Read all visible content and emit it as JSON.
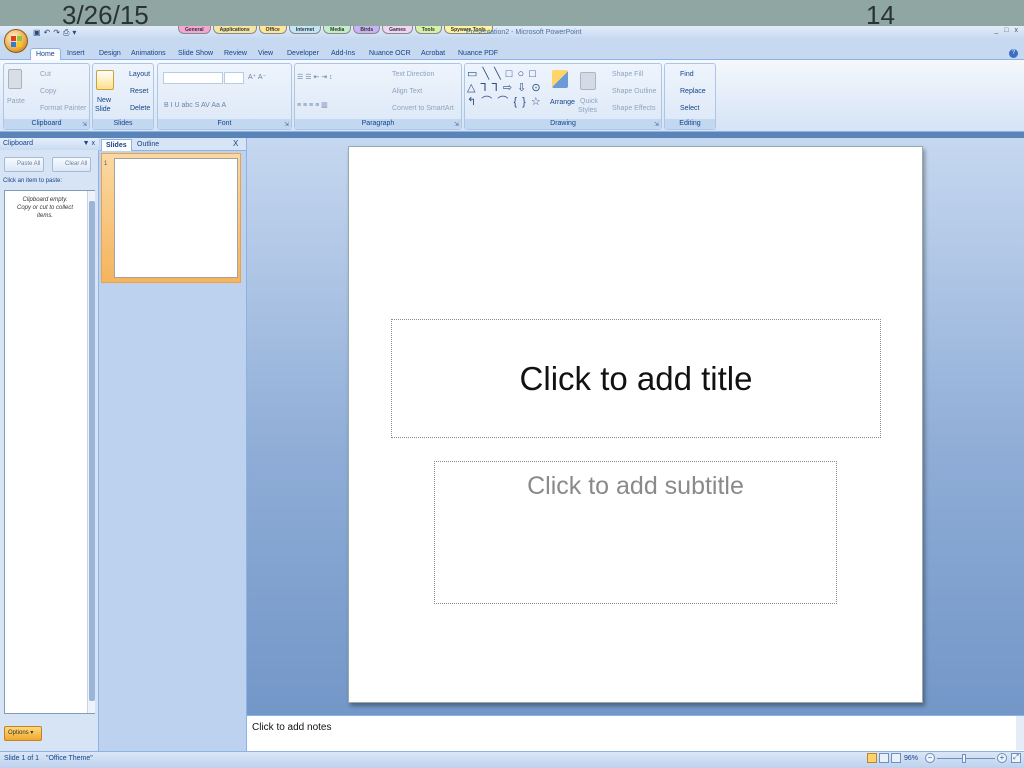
{
  "frame": {
    "date": "3/26/15",
    "page_number": "14"
  },
  "window": {
    "title": "Presentation2 - Microsoft PowerPoint",
    "minimize": "_",
    "maximize": "□",
    "close": "x"
  },
  "qat_icons": [
    "save-icon",
    "undo-icon",
    "redo-icon",
    "print-icon",
    "customize-qat-icon"
  ],
  "toolbar_tabs": [
    {
      "label": "General",
      "color": "#f4a7d4"
    },
    {
      "label": "Applications",
      "color": "#f3e7a3"
    },
    {
      "label": "Office",
      "color": "#ffe79a"
    },
    {
      "label": "Internet",
      "color": "#c2e6f7"
    },
    {
      "label": "Media",
      "color": "#c2f0c6"
    },
    {
      "label": "Birds",
      "color": "#c9b3f2"
    },
    {
      "label": "Games",
      "color": "#f0d5f5"
    },
    {
      "label": "Tools",
      "color": "#d6f2a8"
    },
    {
      "label": "Spyware Tools",
      "color": "#fff2a0"
    }
  ],
  "ribbon_tabs": [
    "Home",
    "Insert",
    "Design",
    "Animations",
    "Slide Show",
    "Review",
    "View",
    "Developer",
    "Add-Ins",
    "Nuance OCR",
    "Acrobat",
    "Nuance PDF"
  ],
  "ribbon": {
    "clipboard": {
      "label": "Clipboard",
      "paste": "Paste",
      "cut": "Cut",
      "copy": "Copy",
      "format_painter": "Format Painter"
    },
    "slides": {
      "label": "Slides",
      "new_slide": "New",
      "new_slide_2": "Slide",
      "layout": "Layout",
      "reset": "Reset",
      "delete": "Delete"
    },
    "font": {
      "label": "Font"
    },
    "paragraph": {
      "label": "Paragraph",
      "text_direction": "Text Direction",
      "align_text": "Align Text",
      "convert_smartart": "Convert to SmartArt"
    },
    "drawing": {
      "label": "Drawing",
      "arrange": "Arrange",
      "quick_styles": "Quick",
      "quick_styles_2": "Styles",
      "shape_fill": "Shape Fill",
      "shape_outline": "Shape Outline",
      "shape_effects": "Shape Effects",
      "shapes_row1": "▭ ╲ ╲ □ ○ □",
      "shapes_row2": "△ ⅂ ⅂ ⇨ ⇩ ⊙",
      "shapes_row3": "↰ ⌒ ⌒ { } ☆"
    },
    "editing": {
      "label": "Editing",
      "find": "Find",
      "replace": "Replace",
      "select": "Select"
    }
  },
  "clipboard_pane": {
    "title": "Clipboard",
    "paste_all": "Paste All",
    "clear_all": "Clear All",
    "hint": "Click an item to paste:",
    "empty_line1": "Clipboard empty.",
    "empty_line2": "Copy or cut to collect",
    "empty_line3": "items.",
    "options": "Options"
  },
  "slides_pane": {
    "tab_slides": "Slides",
    "tab_outline": "Outline",
    "close": "X",
    "thumb_number": "1"
  },
  "slide": {
    "title_placeholder": "Click to add title",
    "subtitle_placeholder": "Click to add subtitle"
  },
  "notes": {
    "placeholder": "Click to add notes"
  },
  "status": {
    "slide_info": "Slide 1 of 1",
    "theme": "\"Office Theme\"",
    "zoom": "96%"
  }
}
